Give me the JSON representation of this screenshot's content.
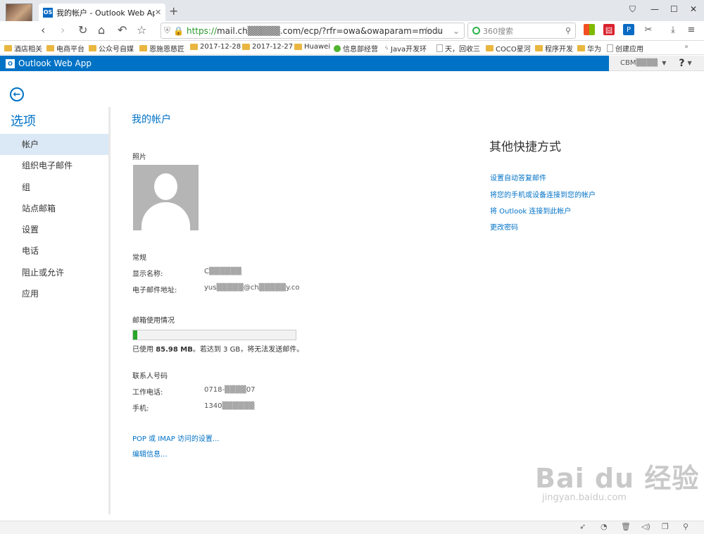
{
  "browser": {
    "tab_title": "我的帐户 - Outlook Web App",
    "tab_favicon": "OS",
    "url_prefix": "https://",
    "url_rest": "mail.ch▒▒▒▒▒.com/ecp/?rfr=owa&owaparam=modu",
    "search_placeholder": "360搜索",
    "bookmarks": [
      "酒店相关",
      "电商平台",
      "公众号自媒",
      "恩施恩慈匠",
      "2017-12-28",
      "2017-12-27",
      "Huawei",
      "信息部经营",
      "Java开发环",
      "天，回收三",
      "COCO星河",
      "程序开发",
      "华为",
      "创建应用"
    ],
    "ext_colors": [
      "#f25022",
      "#d9232e",
      "#0a6bc4"
    ]
  },
  "owa": {
    "app_name": "Outlook Web App",
    "logo": "O",
    "user": "CBM▒▒▒▒",
    "help": "?"
  },
  "sidebar": {
    "title": "选项",
    "items": [
      "帐户",
      "组织电子邮件",
      "组",
      "站点邮箱",
      "设置",
      "电话",
      "阻止或允许",
      "应用"
    ]
  },
  "main": {
    "title": "我的帐户",
    "photo_label": "照片",
    "general_label": "常规",
    "display_name_label": "显示名称:",
    "display_name_value": "C▒▒▒▒▒▒",
    "email_label": "电子邮件地址:",
    "email_value": "yus▒▒▒▒▒@ch▒▒▒▒▒y.co",
    "mailbox_label": "邮箱使用情况",
    "usage_prefix": "已使用",
    "usage_amount": "85.98 MB",
    "usage_suffix": "。若达到 3 GB，将无法发送邮件。",
    "usage_fraction": 0.028,
    "contact_label": "联系人号码",
    "work_phone_label": "工作电话:",
    "work_phone_value": "0718-▒▒▒▒07",
    "mobile_label": "手机:",
    "mobile_value": "1340▒▒▒▒▒▒",
    "pop_imap_link": "POP 或 IMAP 访问的设置...",
    "edit_link": "编辑信息..."
  },
  "shortcuts": {
    "title": "其他快捷方式",
    "links": [
      "设置自动答复邮件",
      "将您的手机或设备连接到您的帐户",
      "将 Outlook 连接到此帐户",
      "更改密码"
    ]
  },
  "watermark": {
    "big": "Bai du 经验",
    "small": "jingyan.baidu.com"
  }
}
